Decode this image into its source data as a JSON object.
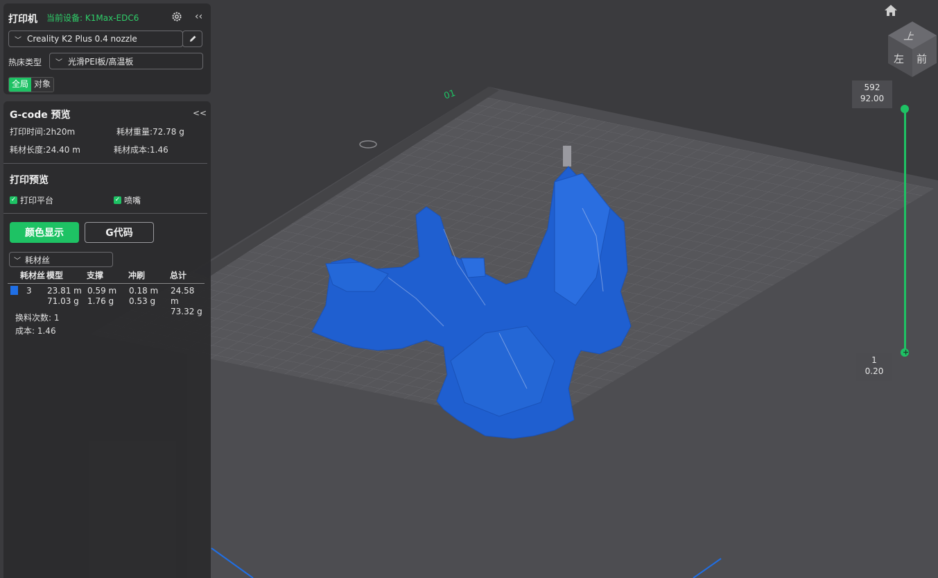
{
  "printer": {
    "title": "打印机",
    "current_device": "当前设备: K1Max-EDC6",
    "profile": "Creality K2 Plus 0.4 nozzle",
    "bed_label": "热床类型",
    "bed_value": "光滑PEI板/高温板",
    "scope_tabs": [
      "全局",
      "对象"
    ],
    "collapse": "‹‹"
  },
  "gcode": {
    "title": "G-code 预览",
    "collapse": "<<",
    "print_time": "打印时间:2h20m",
    "filament_weight": "耗材重量:72.78 g",
    "filament_length": "耗材长度:24.40 m",
    "filament_cost": "耗材成本:1.46"
  },
  "preview": {
    "title": "打印预览",
    "checks": [
      "打印平台",
      "喷嘴"
    ],
    "btn_color": "颜色显示",
    "btn_gcode": "G代码",
    "dropdown": "耗材丝"
  },
  "table": {
    "headers": [
      "耗材丝",
      "模型",
      "支撑",
      "冲刷",
      "总计"
    ],
    "row": {
      "id": "3",
      "model": [
        "23.81 m",
        "71.03 g"
      ],
      "support": [
        "0.59 m",
        "1.76 g"
      ],
      "flush": [
        "0.18 m",
        "0.53 g"
      ],
      "total": [
        "24.58 m",
        "73.32 g"
      ]
    },
    "swatch_color": "#1f6fe6"
  },
  "summary": {
    "changes": "换料次数:  1",
    "cost": "成本:  1.46"
  },
  "slider": {
    "top_layer": "592",
    "top_height": "92.00",
    "bottom_layer": "1",
    "bottom_height": "0.20"
  },
  "viewcube": {
    "top": "上",
    "left": "左",
    "front": "前"
  },
  "colors": {
    "accent": "#1ec264",
    "model": "#1f5fd0",
    "bed": "#5a5a5e"
  }
}
